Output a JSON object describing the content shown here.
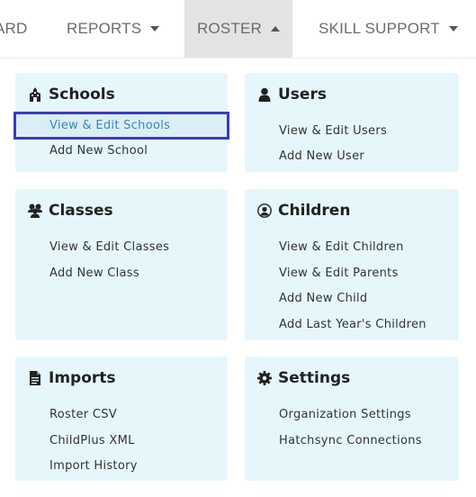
{
  "nav": {
    "items": [
      {
        "label": "ARD"
      },
      {
        "label": "REPORTS"
      },
      {
        "label": "ROSTER"
      },
      {
        "label": "SKILL SUPPORT"
      }
    ]
  },
  "cards": {
    "schools": {
      "title": "Schools",
      "links": [
        "View & Edit Schools",
        "Add New School"
      ]
    },
    "users": {
      "title": "Users",
      "links": [
        "View & Edit Users",
        "Add New User"
      ]
    },
    "classes": {
      "title": "Classes",
      "links": [
        "View & Edit Classes",
        "Add New Class"
      ]
    },
    "children": {
      "title": "Children",
      "links": [
        "View & Edit Children",
        "View & Edit Parents",
        "Add New Child",
        "Add Last Year's Children"
      ]
    },
    "imports": {
      "title": "Imports",
      "links": [
        "Roster CSV",
        "ChildPlus XML",
        "Import History"
      ]
    },
    "settings": {
      "title": "Settings",
      "links": [
        "Organization Settings",
        "Hatchsync Connections"
      ]
    }
  },
  "colors": {
    "card_bg": "#e6f7fc",
    "highlight_border": "#3b3bbf",
    "highlight_text": "#3a87b5",
    "active_tab_bg": "#e3e3e3"
  }
}
